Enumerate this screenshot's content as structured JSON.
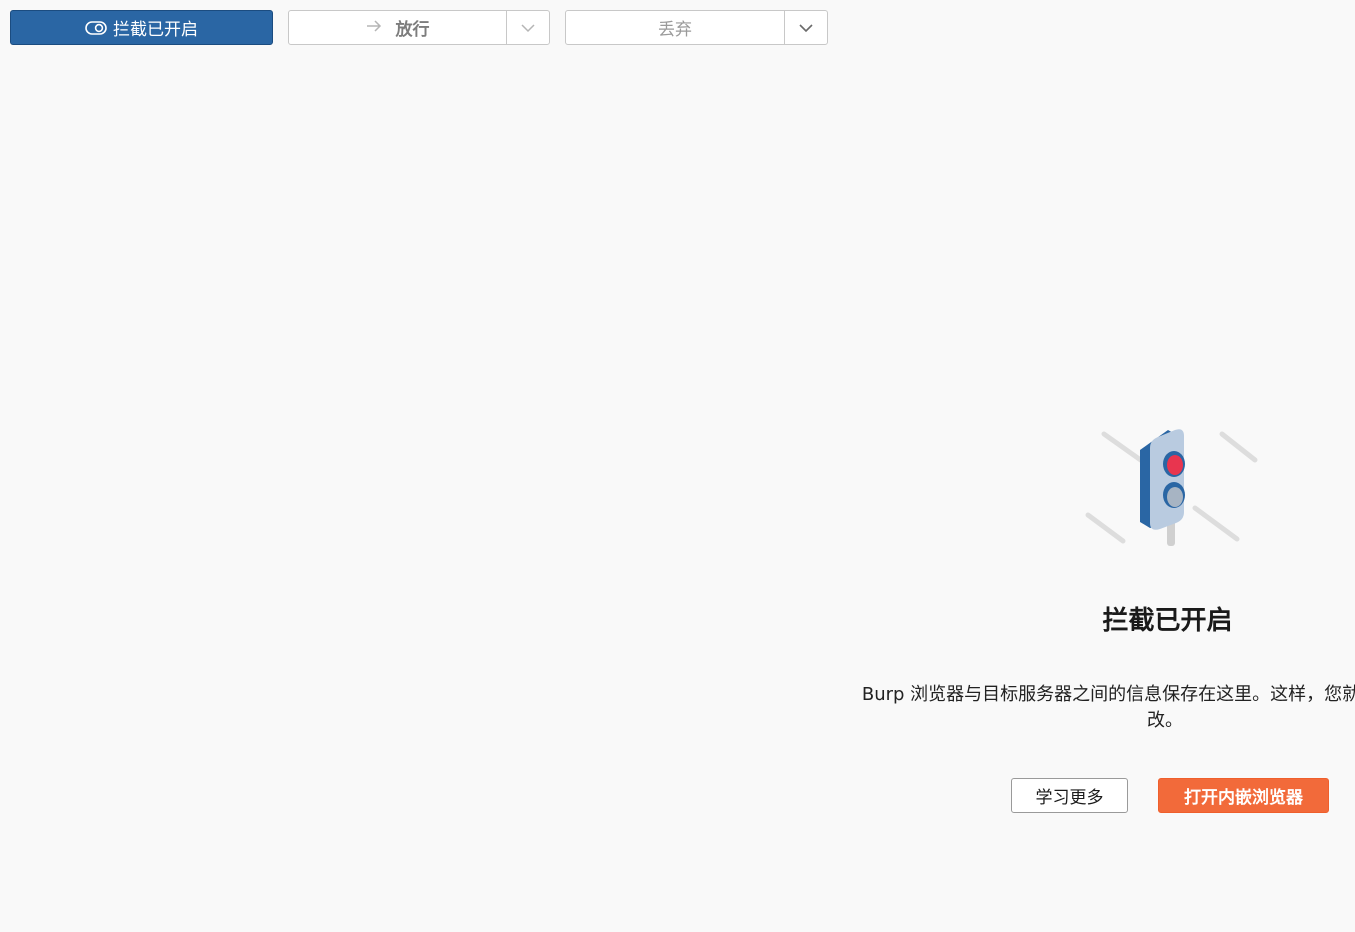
{
  "toolbar": {
    "intercept_label": "拦截已开启",
    "forward_label": "放行",
    "drop_label": "丢弃"
  },
  "empty_state": {
    "title": "拦截已开启",
    "description_line1": "Burp 浏览器与目标服务器之间的信息保存在这里。这样，您就可以在转发这",
    "description_line2": "改。",
    "learn_more_label": "学习更多",
    "open_browser_label": "打开内嵌浏览器"
  },
  "icons": {
    "intercept_toggle": "toggle-icon",
    "forward_arrow": "arrow-right-icon",
    "dropdown": "chevron-down-icon",
    "illustration": "traffic-light-icon"
  },
  "colors": {
    "intercept_button": "#2a66a4",
    "primary_action": "#f26a3a",
    "background": "#f9f9f9"
  }
}
